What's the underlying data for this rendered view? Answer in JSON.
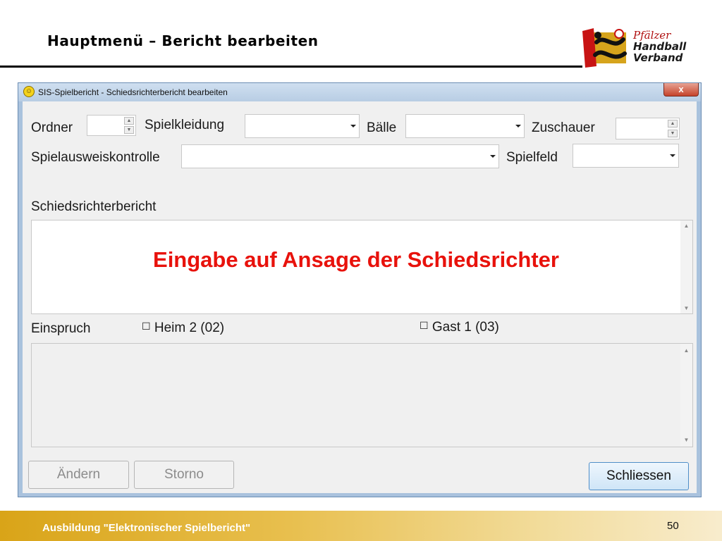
{
  "slide": {
    "title": "Hauptmenü – Bericht bearbeiten",
    "footer": "Ausbildung \"Elektronischer Spielbericht\"",
    "page_number": "50",
    "logo": {
      "line1": "Pfälzer",
      "line2": "Handball",
      "line3": "Verband"
    }
  },
  "window": {
    "title": "SIS-Spielbericht - Schiedsrichterbericht bearbeiten",
    "close_label": "x",
    "row1": {
      "ordner_label": "Ordner",
      "ordner_value": "",
      "spielkleidung_label": "Spielkleidung",
      "spielkleidung_value": "",
      "baelle_label": "Bälle",
      "baelle_value": "",
      "zuschauer_label": "Zuschauer",
      "zuschauer_value": ""
    },
    "row2": {
      "spielausweis_label": "Spielausweiskontrolle",
      "spielausweis_value": "",
      "spielfeld_label": "Spielfeld",
      "spielfeld_value": ""
    },
    "report": {
      "label": "Schiedsrichterbericht",
      "overlay_text": "Eingabe auf Ansage der Schiedsrichter"
    },
    "einspruch": {
      "label": "Einspruch",
      "heim": "Heim 2 (02)",
      "gast": "Gast 1 (03)"
    },
    "buttons": {
      "aendern": "Ändern",
      "storno": "Storno",
      "schliessen": "Schliessen"
    }
  },
  "colors": {
    "accent_red": "#e8120c",
    "footer_gold": "#d9a418",
    "primary_border": "#4f8ec8"
  }
}
